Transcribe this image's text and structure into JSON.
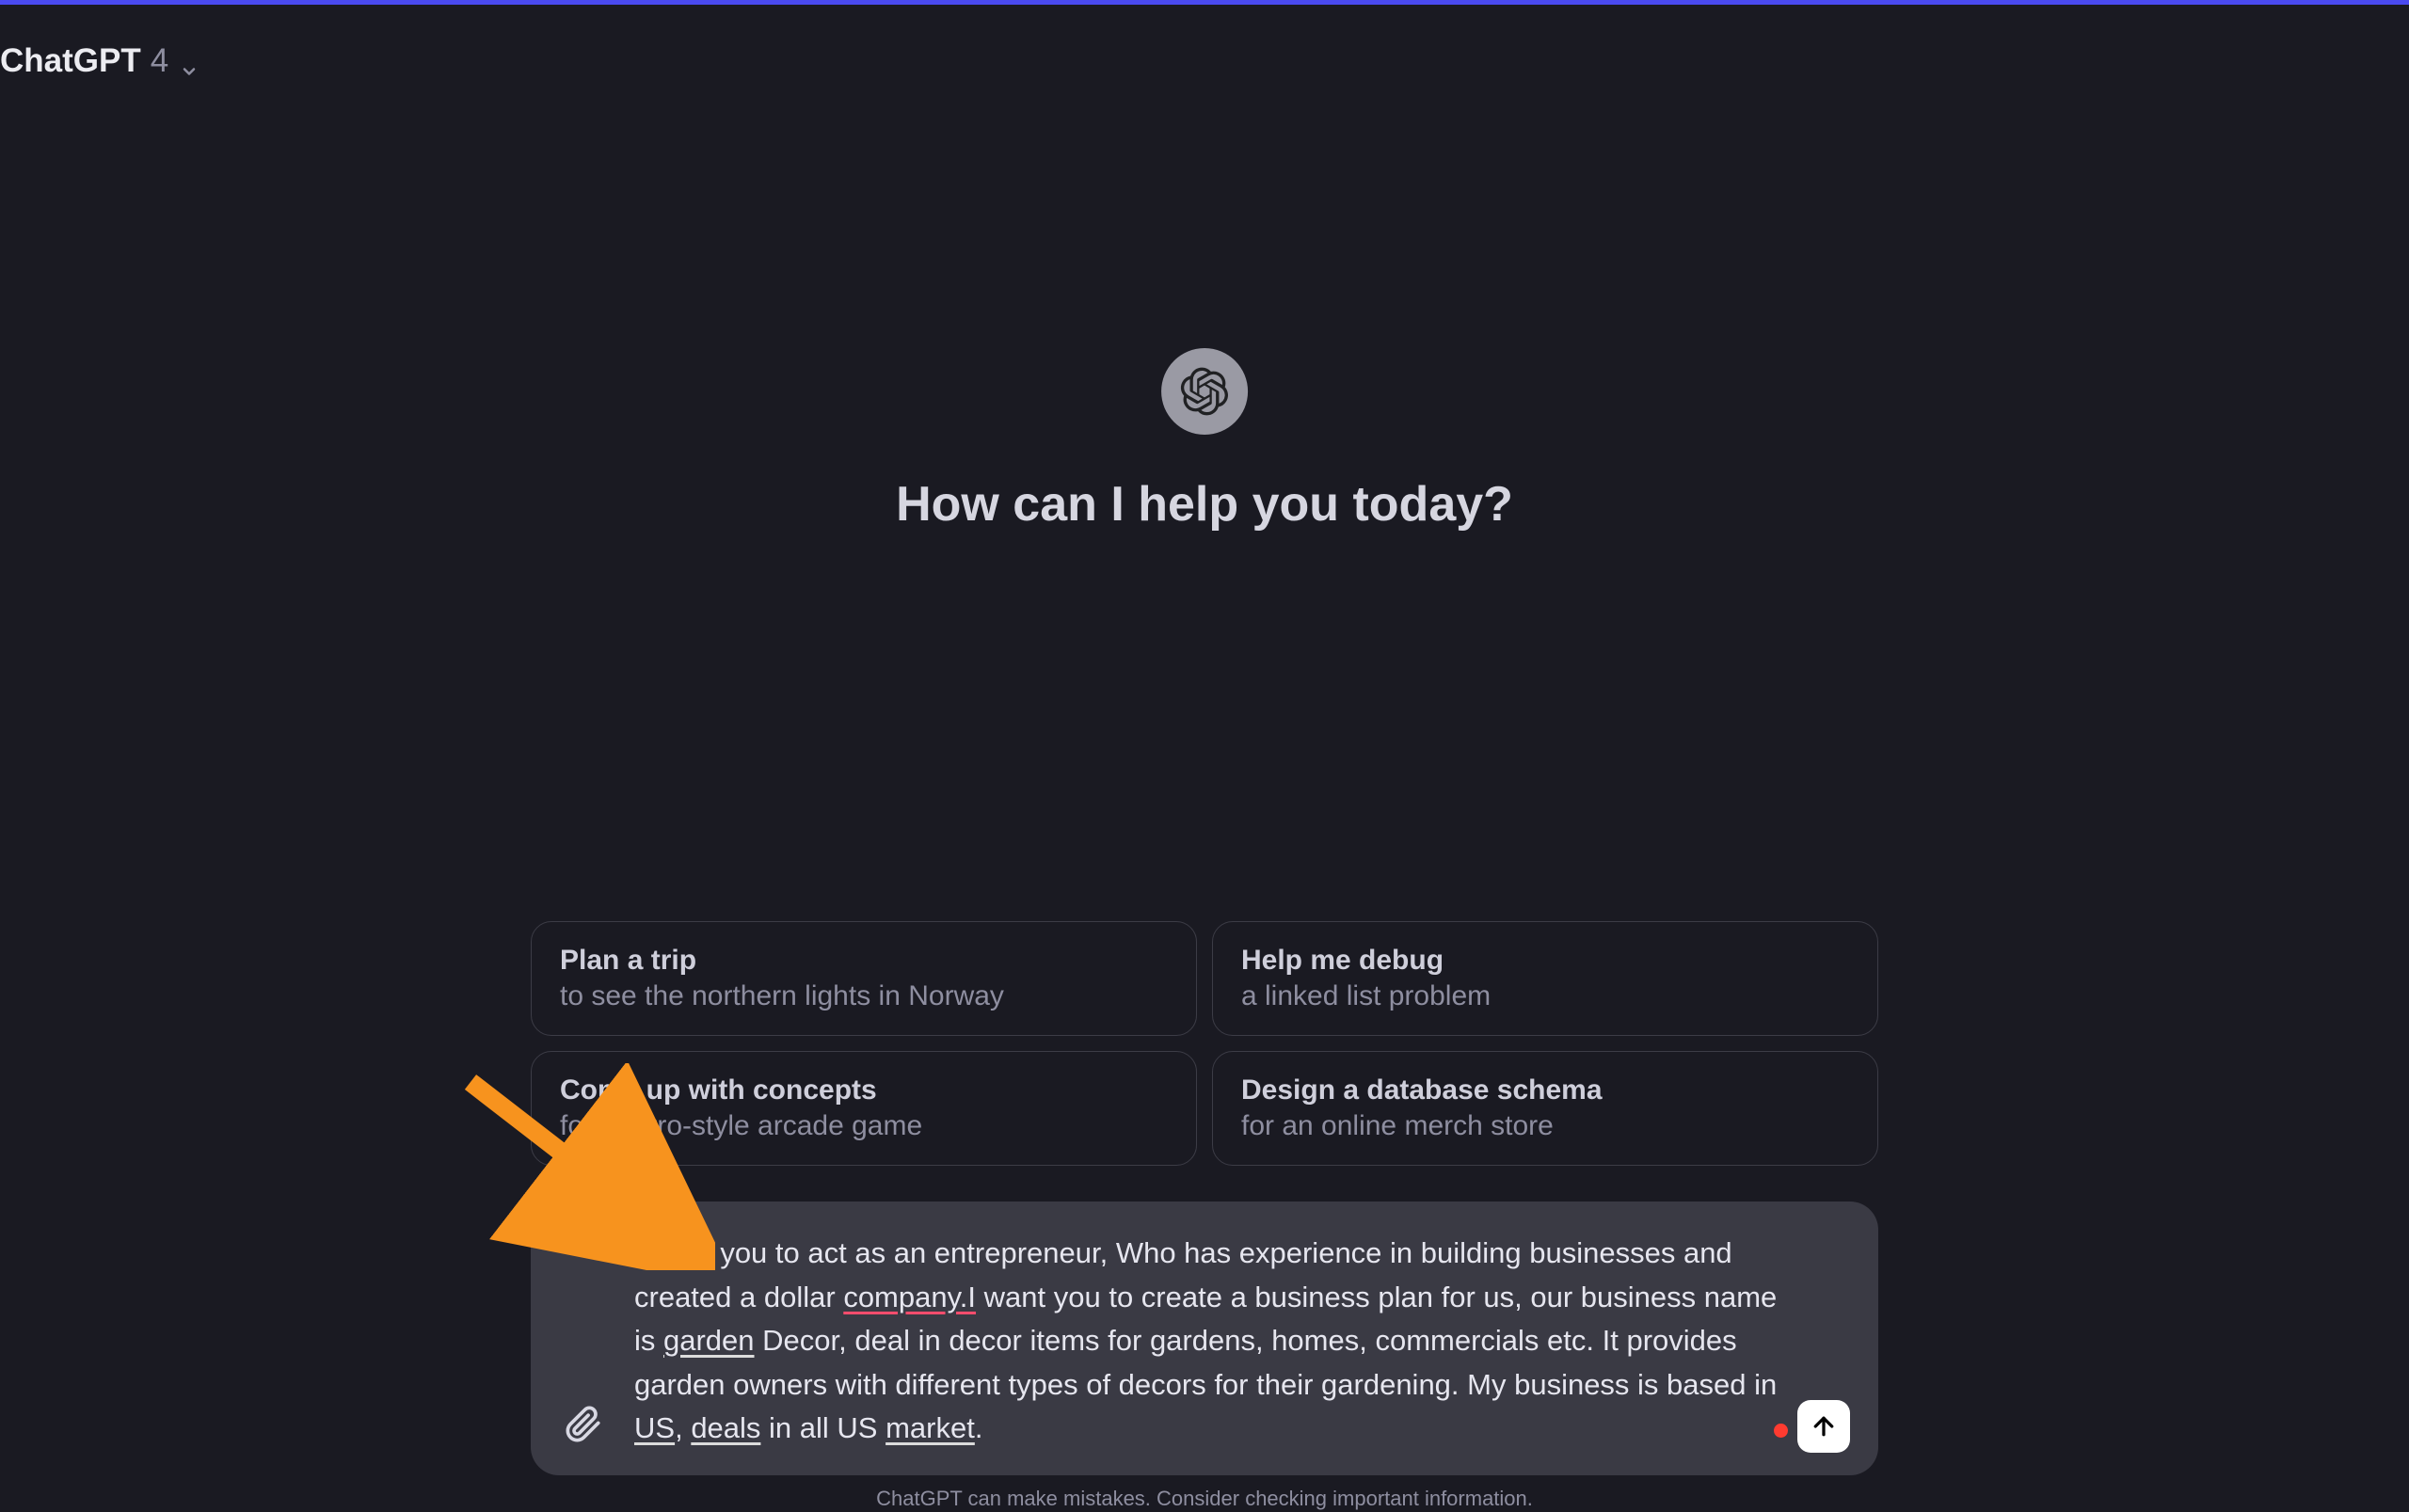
{
  "header": {
    "model_name": "ChatGPT",
    "model_version": "4"
  },
  "hero": {
    "title": "How can I help you today?"
  },
  "suggestions": [
    {
      "title": "Plan a trip",
      "subtitle": "to see the northern lights in Norway"
    },
    {
      "title": "Help me debug",
      "subtitle": "a linked list problem"
    },
    {
      "title": "Come up with concepts",
      "subtitle": "for a retro-style arcade game"
    },
    {
      "title": "Design a database schema",
      "subtitle": "for an online merch store"
    }
  ],
  "input": {
    "segments": [
      {
        "text": "I want you to act as an entrepreneur, Who has experience in building businesses and created a dollar ",
        "style": "plain"
      },
      {
        "text": "company.I",
        "style": "spell"
      },
      {
        "text": " want you to create a business plan for us, our business name is ",
        "style": "plain"
      },
      {
        "text": "garden",
        "style": "grammar"
      },
      {
        "text": " Decor, deal in decor items for gardens, homes, commercials etc. It provides garden owners with different types of decors for their gardening. My business is based in ",
        "style": "plain"
      },
      {
        "text": "US",
        "style": "grammar"
      },
      {
        "text": ", ",
        "style": "plain"
      },
      {
        "text": "deals",
        "style": "grammar"
      },
      {
        "text": " in all US ",
        "style": "plain"
      },
      {
        "text": "market",
        "style": "grammar"
      },
      {
        "text": ".",
        "style": "plain"
      }
    ]
  },
  "footer": {
    "disclaimer": "ChatGPT can make mistakes. Consider checking important information."
  },
  "annotation": {
    "arrow_color": "#f7931e"
  }
}
